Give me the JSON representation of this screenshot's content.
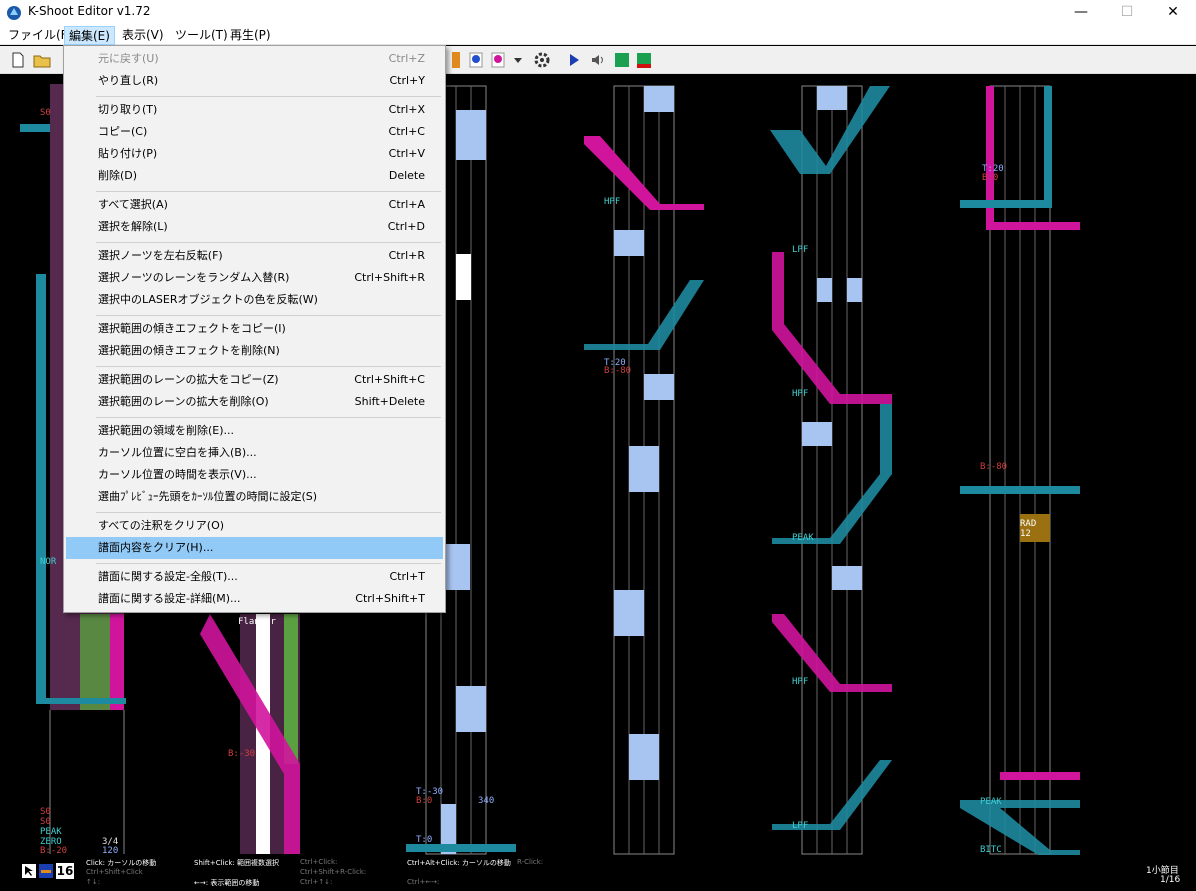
{
  "window": {
    "title": "K-Shoot Editor v1.72",
    "min": "—",
    "max": "☐",
    "close": "✕"
  },
  "menubar": {
    "items": [
      "ファイル(F)",
      "編集(E)",
      "表示(V)",
      "ツール(T)",
      "再生(P)"
    ]
  },
  "dropdown": {
    "items": [
      {
        "label": "元に戻す(U)",
        "shortcut": "Ctrl+Z",
        "disabled": true
      },
      {
        "label": "やり直し(R)",
        "shortcut": "Ctrl+Y"
      },
      {
        "label": "切り取り(T)",
        "shortcut": "Ctrl+X"
      },
      {
        "label": "コピー(C)",
        "shortcut": "Ctrl+C"
      },
      {
        "label": "貼り付け(P)",
        "shortcut": "Ctrl+V"
      },
      {
        "label": "削除(D)",
        "shortcut": "Delete"
      },
      {
        "label": "すべて選択(A)",
        "shortcut": "Ctrl+A"
      },
      {
        "label": "選択を解除(L)",
        "shortcut": "Ctrl+D"
      },
      {
        "label": "選択ノーツを左右反転(F)",
        "shortcut": "Ctrl+R"
      },
      {
        "label": "選択ノーツのレーンをランダム入替(R)",
        "shortcut": "Ctrl+Shift+R"
      },
      {
        "label": "選択中のLASERオブジェクトの色を反転(W)",
        "shortcut": ""
      },
      {
        "label": "選択範囲の傾きエフェクトをコピー(I)",
        "shortcut": ""
      },
      {
        "label": "選択範囲の傾きエフェクトを削除(N)",
        "shortcut": ""
      },
      {
        "label": "選択範囲のレーンの拡大をコピー(Z)",
        "shortcut": "Ctrl+Shift+C"
      },
      {
        "label": "選択範囲のレーンの拡大を削除(O)",
        "shortcut": "Shift+Delete"
      },
      {
        "label": "選択範囲の領域を削除(E)...",
        "shortcut": ""
      },
      {
        "label": "カーソル位置に空白を挿入(B)...",
        "shortcut": ""
      },
      {
        "label": "カーソル位置の時間を表示(V)...",
        "shortcut": ""
      },
      {
        "label": "選曲ﾌﾟﾚﾋﾞｭｰ先頭をｶｰｿﾙ位置の時間に設定(S)",
        "shortcut": ""
      },
      {
        "label": "すべての注釈をクリア(O)",
        "shortcut": ""
      },
      {
        "label": "譜面内容をクリア(H)...",
        "shortcut": "",
        "highlighted": true
      },
      {
        "label": "譜面に関する設定-全般(T)...",
        "shortcut": "Ctrl+T"
      },
      {
        "label": "譜面に関する設定-詳細(M)...",
        "shortcut": "Ctrl+Shift+T"
      }
    ]
  },
  "chart_labels": {
    "hpf": "HPF",
    "lpf": "LPF",
    "peak": "PEAK",
    "bitc": "BITC",
    "rad": "RAD",
    "rad_num": "12",
    "nor": "NOR",
    "flanger": "Flanger",
    "t20": "T:20",
    "b80": "B:-80",
    "b0": "B:0",
    "t30": "T:-30",
    "b30": "B:-30",
    "t0": "T:0",
    "n340": "340",
    "s0": "S0",
    "zero": "ZERO",
    "b20": "B:-20",
    "n34": "3/4",
    "n120": "120"
  },
  "status": {
    "grid_value": "16",
    "click": "Click: カーソルの移動",
    "ctrl_shift_click": "Ctrl+Shift+Click",
    "arrows_ud": "↑↓:",
    "shift_click": "Shift+Click: 範囲複数選択",
    "arrows_lr": "←→: 表示範囲の移動",
    "ctrl_click": "Ctrl+Click:",
    "ctrl_shift_r_click": "Ctrl+Shift+R-Click:",
    "ctrl_arrows": "Ctrl+↑↓:",
    "ctrl_alt_click": "Ctrl+Alt+Click: カーソルの移動",
    "r_click": "R-Click:",
    "ctrl_lr": "Ctrl+←→:",
    "measure_label": "1小節目",
    "measure_div": "1/16"
  },
  "colors": {
    "laser_blue": "#1e8aa0",
    "laser_pink": "#d0149c",
    "fx_orange": "#e08a1e",
    "bt_white": "#ffffff",
    "lane_line": "#888888",
    "menu_hl": "#91c9f7"
  }
}
